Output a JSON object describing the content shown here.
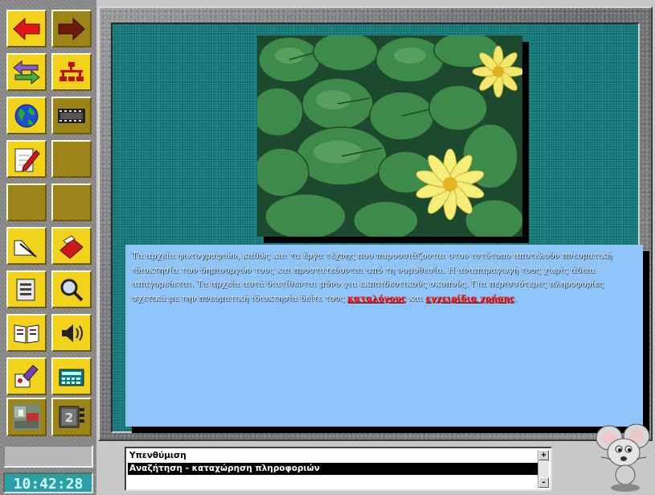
{
  "toolbar": {
    "buttons": [
      {
        "id": "back",
        "icon": "arrow-left-icon"
      },
      {
        "id": "forward",
        "icon": "arrow-right-icon"
      },
      {
        "id": "swap",
        "icon": "swap-arrows-icon"
      },
      {
        "id": "network",
        "icon": "network-tree-icon"
      },
      {
        "id": "globe",
        "icon": "globe-icon"
      },
      {
        "id": "film",
        "icon": "film-strip-icon"
      },
      {
        "id": "notes",
        "icon": "notepad-pencil-icon"
      },
      {
        "id": "blank1",
        "icon": ""
      },
      {
        "id": "blank2",
        "icon": ""
      },
      {
        "id": "blank3",
        "icon": ""
      },
      {
        "id": "draw",
        "icon": "draw-tool-icon"
      },
      {
        "id": "erase",
        "icon": "eraser-hand-icon"
      },
      {
        "id": "document",
        "icon": "document-list-icon"
      },
      {
        "id": "search",
        "icon": "magnifier-icon"
      },
      {
        "id": "book",
        "icon": "open-book-icon"
      },
      {
        "id": "sound",
        "icon": "speaker-icon"
      },
      {
        "id": "paint",
        "icon": "paint-hand-icon"
      },
      {
        "id": "calculator",
        "icon": "calculator-icon"
      },
      {
        "id": "video",
        "icon": "video-thumbnail-icon"
      },
      {
        "id": "slides",
        "icon": "slide-counter-icon"
      }
    ],
    "slide_counter": "2"
  },
  "clock": {
    "time": "10:42:28"
  },
  "content": {
    "image_name": "water-lily-photo",
    "paragraph": "Τα αρχεία φωτογραφιών, καθώς και τα έργα τέχνης που παρουσιάζονται στον ιστότοπο αποτελούν πνευματική ιδιοκτησία των δημιουργών τους και προστατεύονται από τη νομοθεσία. Η αναπαραγωγή τους χωρίς άδεια απαγορεύεται. Τα αρχεία αυτά διατίθενται μόνο για εκπαιδευτικούς σκοπούς. Για περισσότερες πληροφορίες σχετικά με την πνευματική ιδιοκτησία δείτε τους ",
    "link1": "καταλόγους",
    "connector": " και ",
    "link2": "εγχειρίδια χρήσης",
    "ending": "."
  },
  "list": {
    "items": [
      "Υπενθύμιση",
      "Αναζήτηση  -  καταχώρηση  πληροφοριών",
      ""
    ],
    "selected_index": 1,
    "scroll_up": "+",
    "scroll_down": "-"
  },
  "colors": {
    "toolbar_yellow": "#f2d21a",
    "toolbar_olive": "#9c8418",
    "content_teal": "#0f7070",
    "text_panel": "#8fc4f8",
    "link_red": "#ff2020",
    "clock_bg": "#2a9fa8"
  }
}
